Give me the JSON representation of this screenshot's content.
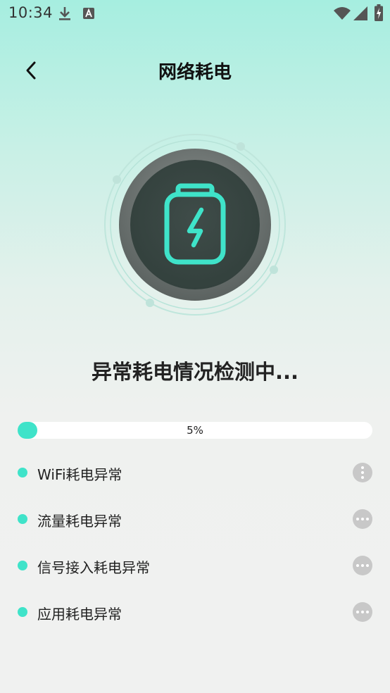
{
  "status_bar": {
    "time": "10:34",
    "icons": [
      "download-icon",
      "a-notification-icon",
      "wifi-icon",
      "signal-icon",
      "battery-charging-icon"
    ]
  },
  "header": {
    "back_icon": "chevron-left-icon",
    "title": "网络耗电"
  },
  "hero": {
    "icon": "battery-charging-icon",
    "accent_color": "#3fe3c9"
  },
  "scan": {
    "status_text": "异常耗电情况检测中...",
    "progress_label": "5%",
    "progress_value": 0.05
  },
  "items": [
    {
      "label": "WiFi耗电异常",
      "state_icon": "more-vertical-icon"
    },
    {
      "label": "流量耗电异常",
      "state_icon": "more-horizontal-icon"
    },
    {
      "label": "信号接入耗电异常",
      "state_icon": "more-horizontal-icon"
    },
    {
      "label": "应用耗电异常",
      "state_icon": "more-horizontal-icon"
    }
  ],
  "colors": {
    "accent": "#3fe3c9",
    "dark_circle": "#3a4a46",
    "bg_top": "#a6eee0",
    "bg_bottom": "#f0f1f0"
  }
}
